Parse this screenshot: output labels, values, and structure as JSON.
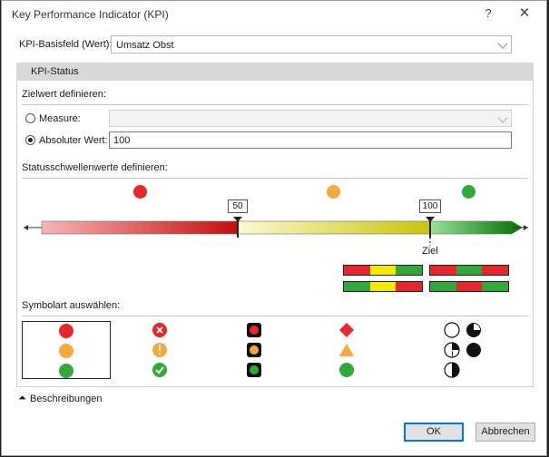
{
  "window": {
    "title": "Key Performance Indicator (KPI)",
    "help_glyph": "?",
    "close_glyph": "✕"
  },
  "base_field": {
    "label": "KPI-Basisfeld (Wert):",
    "value": "Umsatz Obst"
  },
  "status_section": {
    "header": "KPI-Status"
  },
  "target": {
    "label": "Zielwert definieren:",
    "measure_label": "Measure:",
    "measure_value": "",
    "absolute_label": "Absoluter Wert:",
    "absolute_value": "100",
    "selected": "absolute"
  },
  "thresholds": {
    "label": "Statusschwellenwerte definieren:",
    "threshold_low": "50",
    "threshold_high": "100",
    "target_label": "Ziel",
    "colors": {
      "red": "#e8262d",
      "yellow": "#f5a93a",
      "green": "#33a83a"
    }
  },
  "presets": [
    [
      "#e8262d",
      "#f4ea00",
      "#33a83a"
    ],
    [
      "#e8262d",
      "#33a83a",
      "#e8262d"
    ],
    [
      "#33a83a",
      "#f4ea00",
      "#e8262d"
    ],
    [
      "#33a83a",
      "#e8262d",
      "#33a83a"
    ]
  ],
  "symbols": {
    "label": "Symbolart auswählen:",
    "sets": [
      "circles",
      "x-exclamation-check",
      "traffic-light",
      "diamond-triangle-circle",
      "quarter-pies"
    ]
  },
  "descriptions_toggle": {
    "label": "Beschreibungen",
    "icon": "double-chevron-up-icon"
  },
  "buttons": {
    "ok": "OK",
    "cancel": "Abbrechen"
  }
}
